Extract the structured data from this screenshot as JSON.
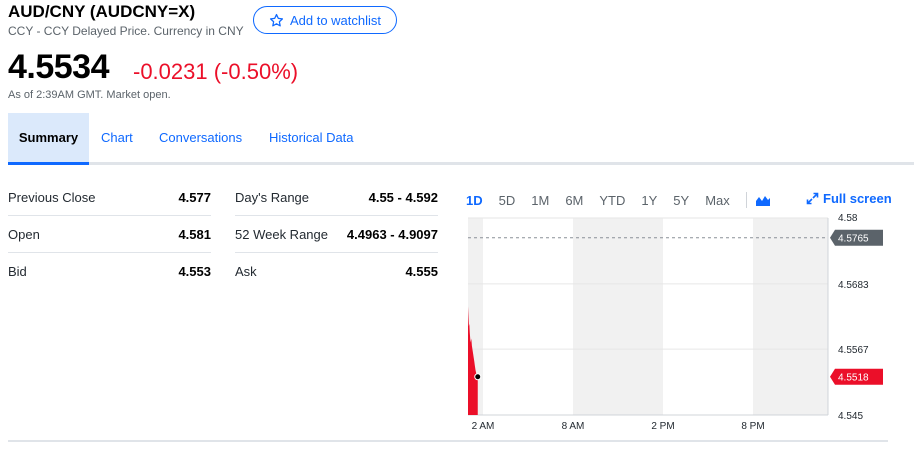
{
  "header": {
    "title": "AUD/CNY (AUDCNY=X)",
    "subtitle": "CCY - CCY Delayed Price. Currency in CNY",
    "watchlist_label": "Add to watchlist",
    "price": "4.5534",
    "change": "-0.0231 (-0.50%)",
    "as_of": "As of 2:39AM GMT. Market open."
  },
  "tabs": [
    {
      "label": "Summary",
      "active": true
    },
    {
      "label": "Chart",
      "active": false
    },
    {
      "label": "Conversations",
      "active": false
    },
    {
      "label": "Historical Data",
      "active": false
    }
  ],
  "stats": {
    "left": [
      {
        "label": "Previous Close",
        "value": "4.577"
      },
      {
        "label": "Open",
        "value": "4.581"
      },
      {
        "label": "Bid",
        "value": "4.553"
      }
    ],
    "right": [
      {
        "label": "Day's Range",
        "value": "4.55 - 4.592"
      },
      {
        "label": "52 Week Range",
        "value": "4.4963 - 4.9097"
      },
      {
        "label": "Ask",
        "value": "4.555"
      }
    ]
  },
  "chart_controls": {
    "ranges": [
      "1D",
      "5D",
      "1M",
      "6M",
      "YTD",
      "1Y",
      "5Y",
      "Max"
    ],
    "active_range": "1D",
    "chart_type_icon": "mountain-chart-icon",
    "fullscreen_label": "Full screen"
  },
  "colors": {
    "accent": "#0f69ff",
    "negative": "#eb0f29",
    "previous_close_marker": "#5b636a"
  },
  "chart_data": {
    "type": "area",
    "x_tick_labels": [
      "2 AM",
      "8 AM",
      "2 PM",
      "8 PM"
    ],
    "y_tick_labels": [
      "4.58",
      "4.5683",
      "4.5567",
      "4.545"
    ],
    "y_ticks": [
      4.58,
      4.5683,
      4.5567,
      4.545
    ],
    "ylim": [
      4.545,
      4.58
    ],
    "x_hours_range": [
      1,
      25
    ],
    "shaded_bands_hours": [
      [
        1,
        2
      ],
      [
        8,
        14
      ],
      [
        20,
        25
      ]
    ],
    "previous_close": {
      "label": "4.5765",
      "value": 4.5765
    },
    "current": {
      "label": "4.5518",
      "value": 4.5518
    },
    "series": [
      {
        "x_hours": [
          1.0,
          1.03,
          1.06,
          1.09,
          1.12,
          1.15,
          1.18,
          1.22,
          1.26,
          1.3,
          1.34,
          1.38,
          1.42,
          1.46,
          1.5,
          1.54,
          1.58,
          1.62,
          1.65
        ],
        "values": [
          4.5643,
          4.5625,
          4.5608,
          4.5612,
          4.5596,
          4.5585,
          4.5579,
          4.5586,
          4.5573,
          4.5566,
          4.5559,
          4.5552,
          4.5545,
          4.5537,
          4.553,
          4.5525,
          4.5521,
          4.5519,
          4.5518
        ]
      }
    ],
    "grid": true
  }
}
